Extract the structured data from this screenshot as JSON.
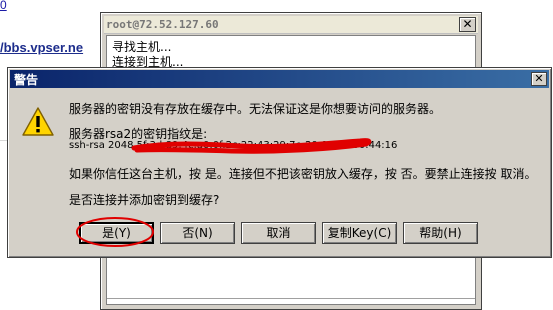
{
  "background": {
    "top_link": "0",
    "link": "/bbs.vpser.ne"
  },
  "back_window": {
    "title": "root@72.52.127.60",
    "close_glyph": "✕",
    "lines": [
      "寻找主机...",
      "连接到主机..."
    ]
  },
  "dialog": {
    "title": "警告",
    "close_glyph": "✕",
    "icon": "warning-icon",
    "messages": {
      "line1": "服务器的密钥没有存放在缓存中。无法保证这是你想要访问的服务器。",
      "line2": "服务器rsa2的密钥指纹是:",
      "line3": "ssh-rsa 2048 5f:3d:89:4c:a0:0f:2c:22:43:29:7e:20:0c:00:00:44:16",
      "line4": "如果你信任这台主机，按 是。连接但不把该密钥放入缓存，按 否。要禁止连接按 取消。",
      "line5": "是否连接并添加密钥到缓存?"
    },
    "buttons": {
      "yes": "是(Y)",
      "no": "否(N)",
      "cancel": "取消",
      "copy_key": "复制Key(C)",
      "help": "帮助(H)"
    }
  },
  "annotation_color": "#e00000"
}
